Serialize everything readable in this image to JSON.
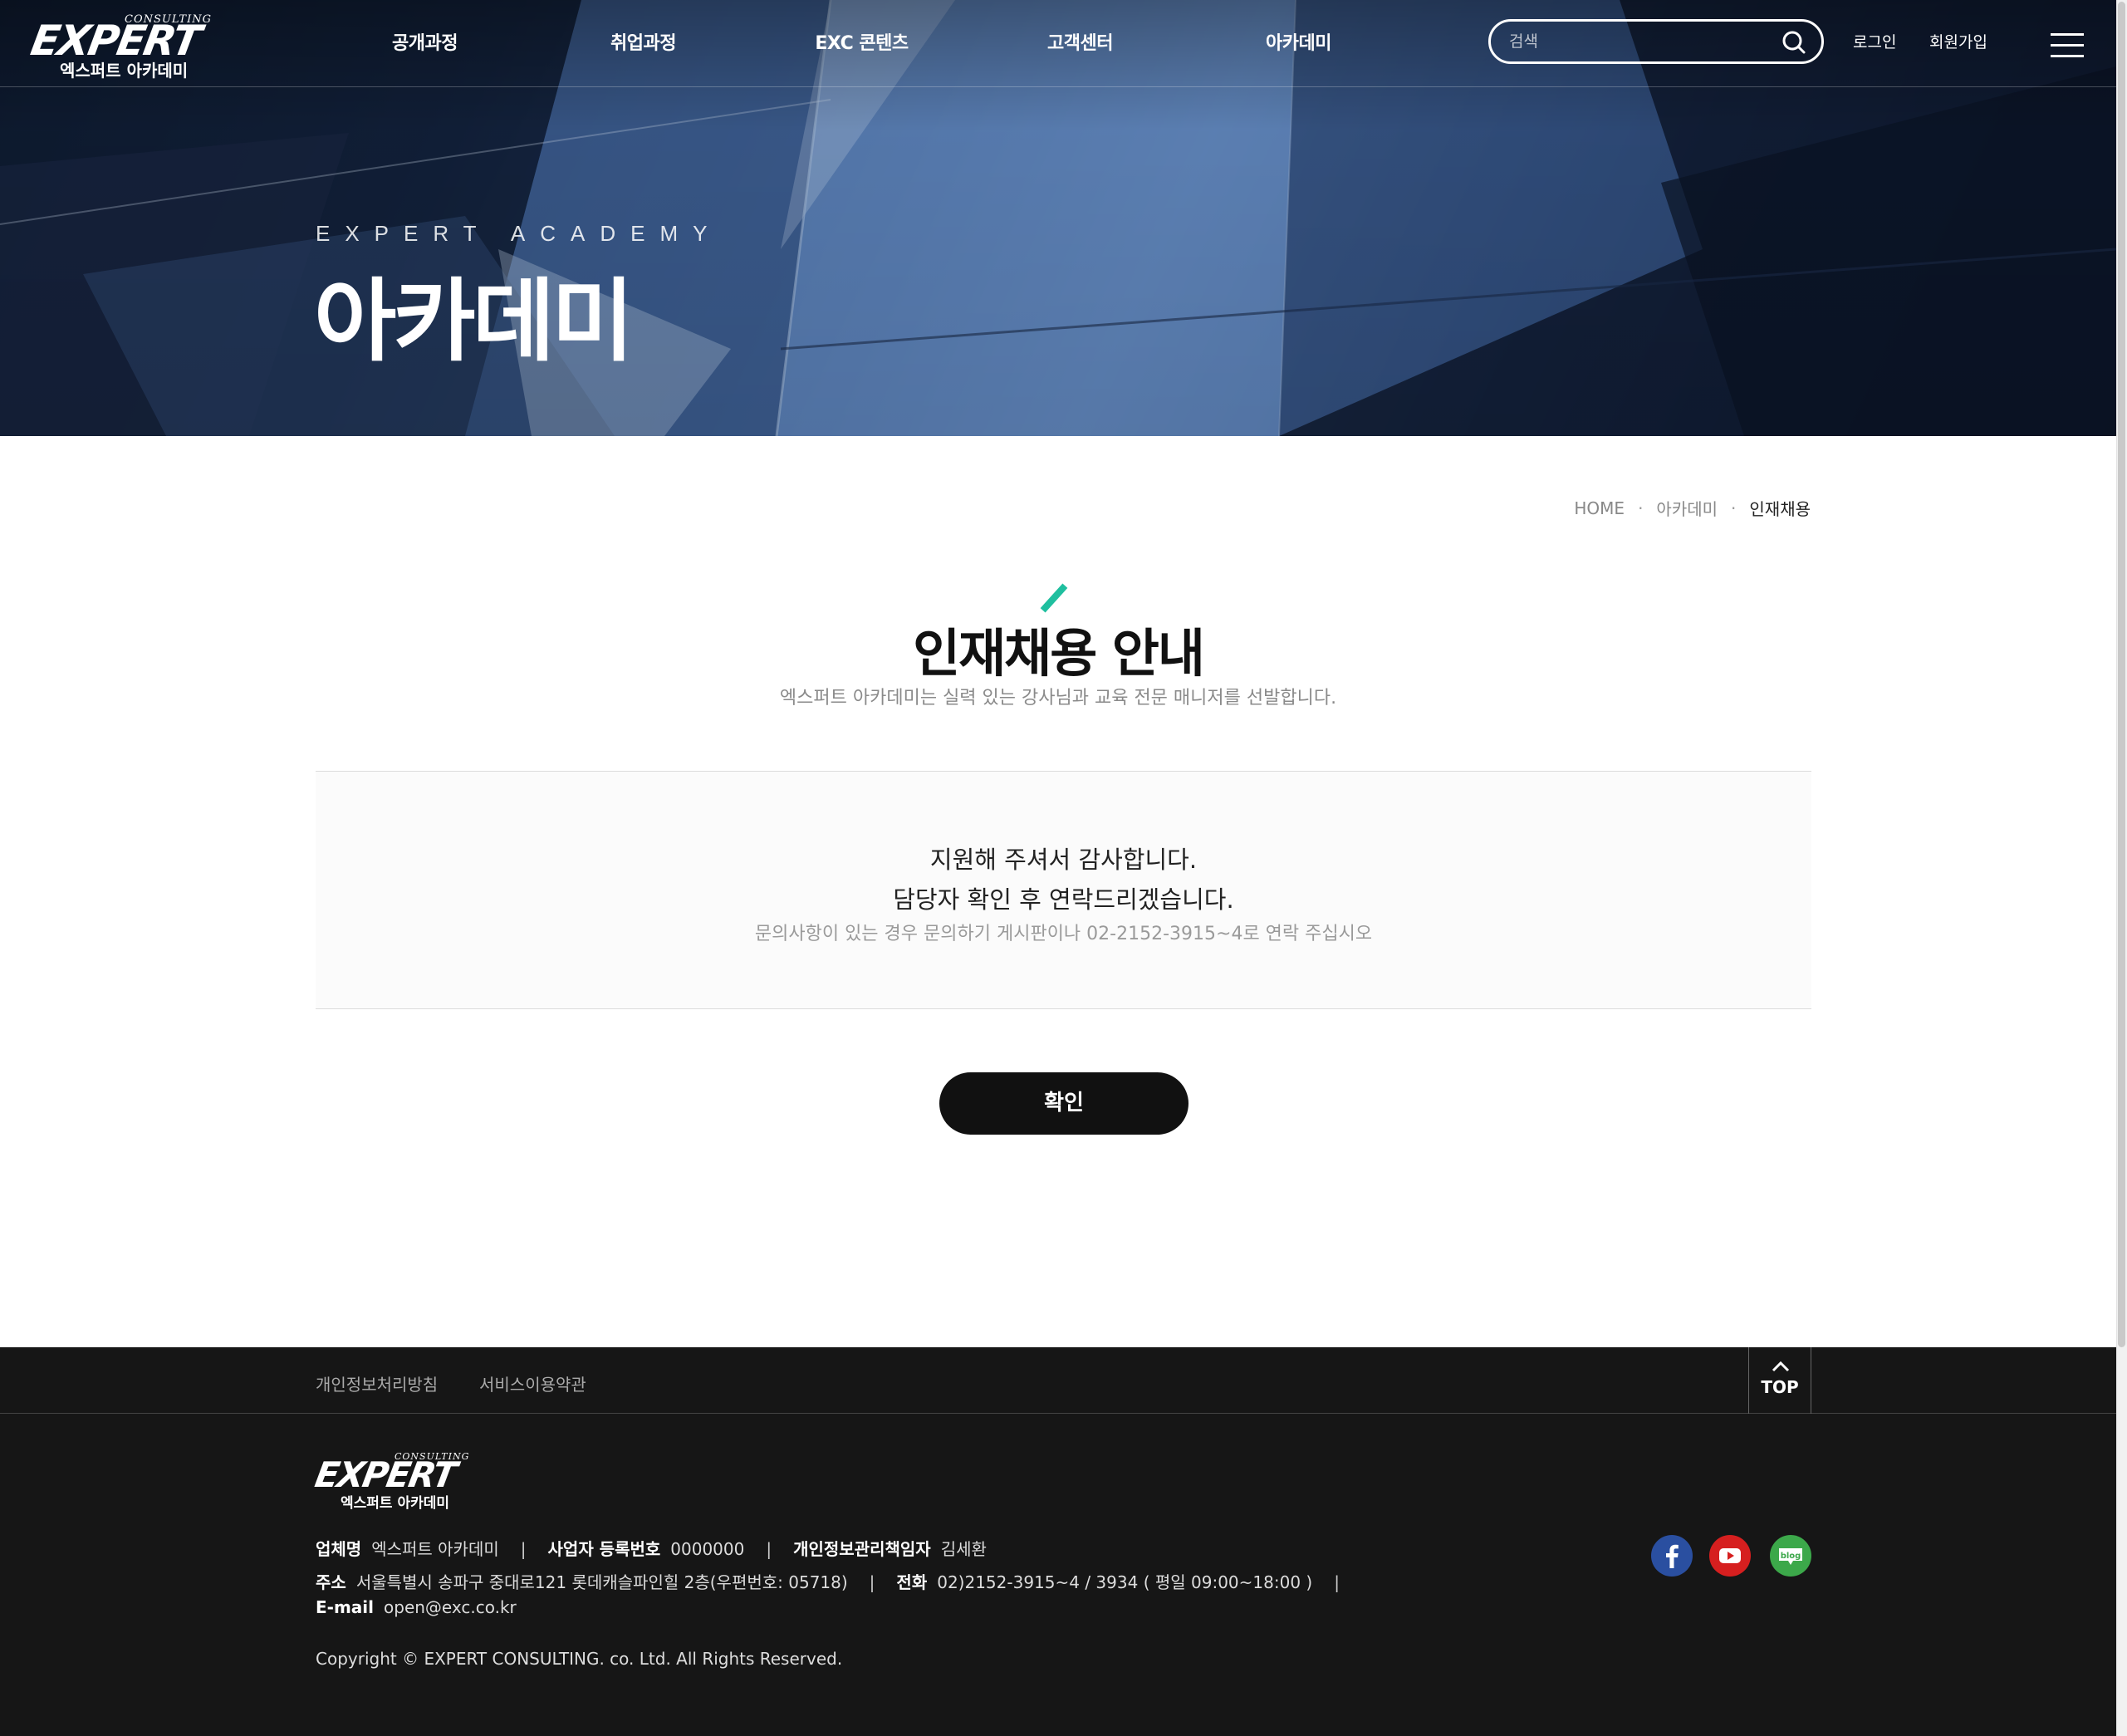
{
  "nav": {
    "logo_word": "EXPERT",
    "logo_tag": "CONSULTING",
    "logo_sub": "엑스퍼트 아카데미",
    "menu": [
      "공개과정",
      "취업과정",
      "EXC 콘텐츠",
      "고객센터",
      "아카데미"
    ],
    "search_placeholder": "검색",
    "login": "로그인",
    "join": "회원가입"
  },
  "hero": {
    "subtitle": "EXPERT ACADEMY",
    "title": "아카데미"
  },
  "breadcrumb": [
    "HOME",
    "아카데미",
    "인재채용"
  ],
  "page": {
    "title": "인재채용 안내",
    "description": "엑스퍼트 아카데미는 실력 있는 강사님과 교육 전문 매니저를 선발합니다.",
    "accent_color": "#1fbf9f"
  },
  "message": {
    "line1": "지원해 주셔서 감사합니다.",
    "line2": "담당자 확인 후 연락드리겠습니다.",
    "line3": "문의사항이 있는 경우 문의하기 게시판이나 02-2152-3915~4로 연락 주십시오"
  },
  "confirm_button": "확인",
  "footer": {
    "links": [
      "개인정보처리방침",
      "서비스이용약관"
    ],
    "top_label": "TOP",
    "logo_word": "EXPERT",
    "logo_tag": "CONSULTING",
    "logo_sub": "엑스퍼트 아카데미",
    "company_label": "업체명",
    "company": "엑스퍼트 아카데미",
    "bizno_label": "사업자 등록번호",
    "bizno": "0000000",
    "privacy_label": "개인정보관리책임자",
    "privacy_officer": "김세환",
    "address_label": "주소",
    "address": "서울특별시 송파구 중대로121 롯데캐슬파인힐 2층(우편번호: 05718)",
    "phone_label": "전화",
    "phone": "02)2152-3915~4 / 3934 ( 평일 09:00~18:00 )",
    "email_label": "E-mail",
    "email": "open@exc.co.kr",
    "copyright": "Copyright © EXPERT CONSULTING. co. Ltd. All Rights Reserved.",
    "social": {
      "facebook_color": "#2a4fa0",
      "youtube_color": "#d61f1f",
      "blog_color": "#3ca84a",
      "blog_label": "blog"
    }
  }
}
